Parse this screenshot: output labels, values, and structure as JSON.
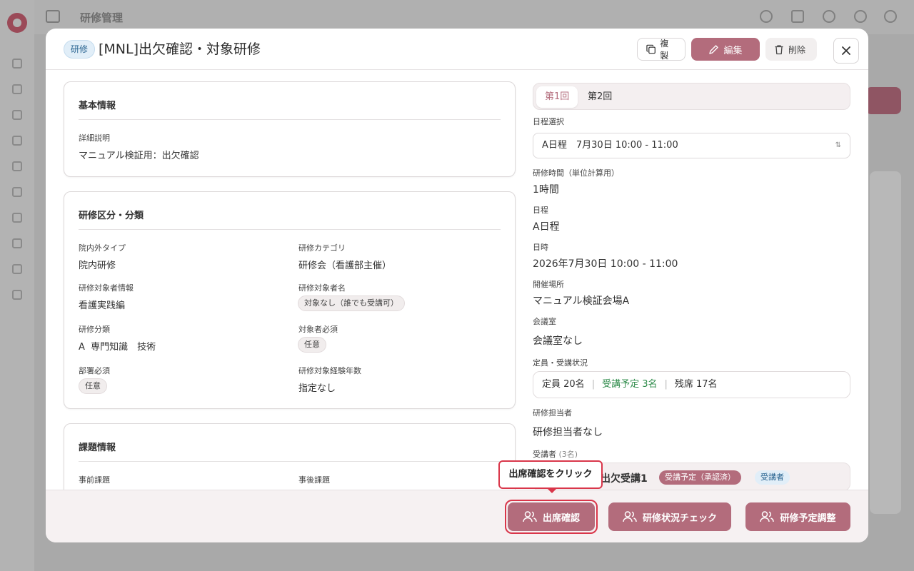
{
  "background": {
    "app_title": "研修管理"
  },
  "modal": {
    "tag": "研修",
    "title": "[MNL]出欠確認・対象研修",
    "actions": {
      "copy": "複製",
      "edit": "編集",
      "delete": "削除"
    }
  },
  "basic_info": {
    "heading": "基本情報",
    "description_label": "詳細説明",
    "description_value": "マニュアル検証用：出欠確認"
  },
  "classification": {
    "heading": "研修区分・分類",
    "fields": {
      "inout_label": "院内外タイプ",
      "inout_value": "院内研修",
      "category_label": "研修カテゴリ",
      "category_value": "研修会（看護部主催）",
      "target_info_label": "研修対象者情報",
      "target_info_value": "看護実践編",
      "target_name_label": "研修対象者名",
      "target_name_value": "対象なし（誰でも受講可）",
      "type_label": "研修分類",
      "type_value": "A  専門知識　技術",
      "required_label": "対象者必須",
      "required_value": "任意",
      "dept_required_label": "部署必須",
      "dept_required_value": "任意",
      "experience_label": "研修対象経験年数",
      "experience_value": "指定なし"
    }
  },
  "assignment": {
    "heading": "課題情報",
    "pre_label": "事前課題",
    "post_label": "事後課題"
  },
  "session": {
    "tabs": [
      "第1回",
      "第2回"
    ],
    "active_tab": "第1回",
    "schedule_label": "日程選択",
    "schedule_value": "A日程　7月30日 10:00 - 11:00",
    "hours_label": "研修時間（単位計算用）",
    "hours_value": "1時間",
    "day_label": "日程",
    "day_value": "A日程",
    "datetime_label": "日時",
    "datetime_value": "2026年7月30日 10:00 - 11:00",
    "place_label": "開催場所",
    "place_value": "マニュアル検証会場A",
    "room_label": "会議室",
    "room_value": "会議室なし",
    "capacity_label": "定員・受講状況",
    "capacity": {
      "total": "定員 20名",
      "planned": "受講予定 3名",
      "remaining": "残席 17名"
    },
    "instructor_label": "研修担当者",
    "instructor_value": "研修担当者なし",
    "attendees_label": "受講者",
    "attendees_count": "(3名)",
    "attendee": {
      "name": "出欠受講1",
      "status": "受講予定（承認済）",
      "role": "受講者"
    }
  },
  "footer": {
    "attendance_button": "出席確認",
    "status_check_button": "研修状況チェック",
    "schedule_adjust_button": "研修予定調整"
  },
  "tooltip": {
    "text": "出席確認をクリック"
  },
  "colors": {
    "accent": "#b36c7c",
    "highlight": "#d9364a",
    "planned_green": "#2e8b4a",
    "tag_blue": "#27628f"
  }
}
